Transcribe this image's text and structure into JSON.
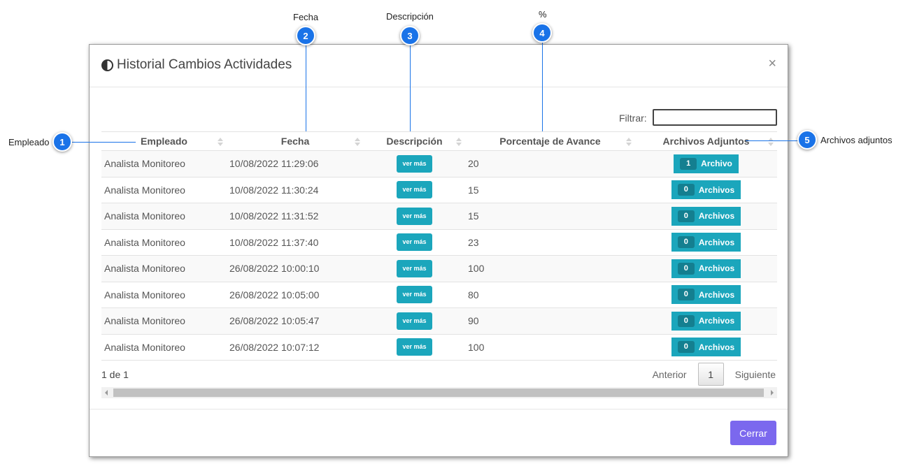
{
  "callouts": [
    {
      "num": "1",
      "label": "Empleado"
    },
    {
      "num": "2",
      "label": "Fecha"
    },
    {
      "num": "3",
      "label": "Descripción"
    },
    {
      "num": "4",
      "label": "%"
    },
    {
      "num": "5",
      "label": "Archivos adjuntos"
    }
  ],
  "modal": {
    "title": "Historial Cambios Actividades",
    "close_label": "×",
    "filter_label": "Filtrar:",
    "filter_value": "",
    "footer_button": "Cerrar"
  },
  "table": {
    "headers": [
      "Empleado",
      "Fecha",
      "Descripción",
      "Porcentaje de Avance",
      "Archivos Adjuntos"
    ],
    "rows": [
      {
        "empleado": "Analista Monitoreo",
        "fecha": "10/08/2022 11:29:06",
        "descripcion": "ver más",
        "porcentaje": "20",
        "count": "1",
        "archivo": "Archivo"
      },
      {
        "empleado": "Analista Monitoreo",
        "fecha": "10/08/2022 11:30:24",
        "descripcion": "ver más",
        "porcentaje": "15",
        "count": "0",
        "archivo": "Archivos"
      },
      {
        "empleado": "Analista Monitoreo",
        "fecha": "10/08/2022 11:31:52",
        "descripcion": "ver más",
        "porcentaje": "15",
        "count": "0",
        "archivo": "Archivos"
      },
      {
        "empleado": "Analista Monitoreo",
        "fecha": "10/08/2022 11:37:40",
        "descripcion": "ver más",
        "porcentaje": "23",
        "count": "0",
        "archivo": "Archivos"
      },
      {
        "empleado": "Analista Monitoreo",
        "fecha": "26/08/2022 10:00:10",
        "descripcion": "ver más",
        "porcentaje": "100",
        "count": "0",
        "archivo": "Archivos"
      },
      {
        "empleado": "Analista Monitoreo",
        "fecha": "26/08/2022 10:05:00",
        "descripcion": "ver más",
        "porcentaje": "80",
        "count": "0",
        "archivo": "Archivos"
      },
      {
        "empleado": "Analista Monitoreo",
        "fecha": "26/08/2022 10:05:47",
        "descripcion": "ver más",
        "porcentaje": "90",
        "count": "0",
        "archivo": "Archivos"
      },
      {
        "empleado": "Analista Monitoreo",
        "fecha": "26/08/2022 10:07:12",
        "descripcion": "ver más",
        "porcentaje": "100",
        "count": "0",
        "archivo": "Archivos"
      }
    ]
  },
  "pagination": {
    "info": "1 de 1",
    "prev": "Anterior",
    "current": "1",
    "next": "Siguiente"
  },
  "colors": {
    "callout": "#1a73e8",
    "teal_button": "#1ba6bc",
    "primary_button": "#7b68ee"
  }
}
